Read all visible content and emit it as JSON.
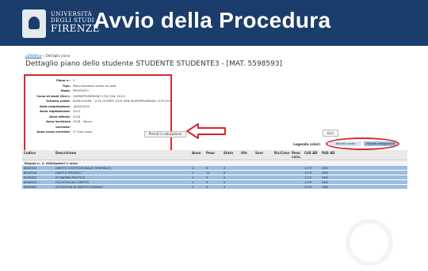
{
  "header": {
    "logo_lines": [
      "UNIVERSITÀ",
      "DEGLI STUDI",
      "FIRENZE"
    ],
    "title": "Avvio della Procedura"
  },
  "breadcrumb": {
    "home": "Didattica",
    "sep": " » ",
    "current": "Dettaglio piano"
  },
  "page_title": "Dettaglio piano dello studente STUDENTE STUDENTE3 - [MAT. 5598593]",
  "details": [
    {
      "label": "Piano n.:",
      "value": "5"
    },
    {
      "label": "Tipo:",
      "value": "Piano Standard scelto via web"
    },
    {
      "label": "Stato:",
      "value": "PROPOSTO"
    },
    {
      "label": "Corso di studi (Ord.):",
      "value": "GIURISPRUDENZA[1170] (Ord. 2012)"
    },
    {
      "label": "Schema scelto:",
      "value": "B000010GPA - 1170-COORTE 2015 GEN GIURISPRUDENZA 1170 2015"
    },
    {
      "label": "Data compilazione:",
      "value": "18/04/2019"
    },
    {
      "label": "Anno regolamento:",
      "value": "2015"
    },
    {
      "label": "Anno offerta:",
      "value": "2018"
    },
    {
      "label": "Anno iscrizione",
      "value": "2018 - 4anno"
    },
    {
      "label": "corrente:",
      "value": ""
    },
    {
      "label": "Anno corso corrente:",
      "value": "5° fuori corso"
    }
  ],
  "buttons": {
    "evaluate": "Prendi in valutazione",
    "exit": "Esci"
  },
  "legend": {
    "label": "Legenda colori:",
    "optional": "Attività scelte",
    "mandatory": "Attività obbligatorie"
  },
  "table": {
    "columns": [
      "Codice",
      "Descrizione",
      "Anno",
      "Peso",
      "Stato",
      "Ofe",
      "Sovr",
      "Ric/Conv",
      "Peso conv.",
      "CdS AD",
      "PdS AD"
    ],
    "group": "Regola n. 1: Obbligatori 1 anno",
    "rows": [
      [
        "B002304",
        "DIRITTO COSTITUZIONALE (GENERALE)",
        "1",
        "9",
        "S",
        "",
        "",
        "",
        "",
        "1170",
        "GEN"
      ],
      [
        "B013026",
        "DIRITTO PRIVATO I",
        "1",
        "12",
        "S",
        "",
        "",
        "",
        "",
        "1170",
        "GEN"
      ],
      [
        "B005802",
        "ECONOMIA POLITICA",
        "1",
        "9",
        "S",
        "",
        "",
        "",
        "",
        "1170",
        "GEN"
      ],
      [
        "B006505",
        "FILOSOFIA DEL DIRITTO",
        "1",
        "9",
        "S",
        "",
        "",
        "",
        "",
        "1170",
        "GEN"
      ],
      [
        "B005663",
        "ISTITUZIONI DI DIRITTO ROMANO",
        "1",
        "9",
        "S",
        "",
        "",
        "",
        "",
        "1170",
        "GEN"
      ]
    ]
  },
  "colors": {
    "banner": "#1b3d6b",
    "highlight": "#d9272e",
    "row": "#9bbde0"
  }
}
